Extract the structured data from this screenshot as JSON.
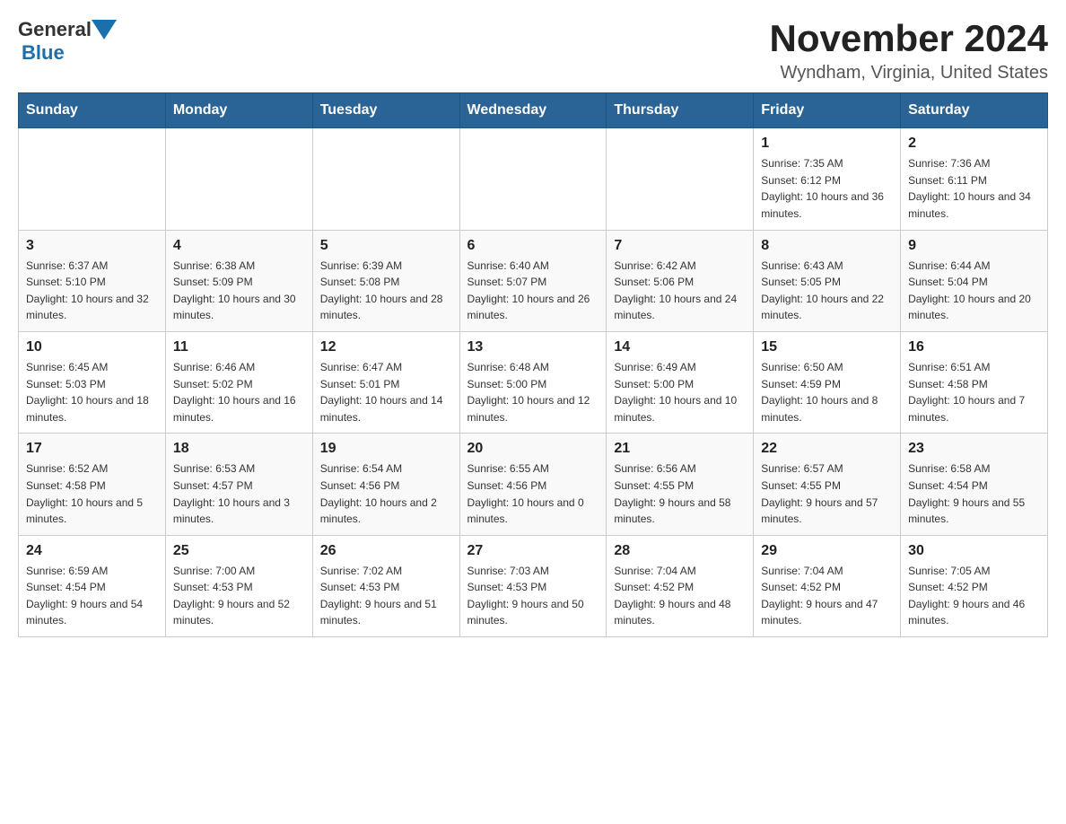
{
  "header": {
    "logo": {
      "general": "General",
      "blue": "Blue"
    },
    "title": "November 2024",
    "location": "Wyndham, Virginia, United States"
  },
  "calendar": {
    "days_of_week": [
      "Sunday",
      "Monday",
      "Tuesday",
      "Wednesday",
      "Thursday",
      "Friday",
      "Saturday"
    ],
    "weeks": [
      {
        "cells": [
          {
            "day": "",
            "info": ""
          },
          {
            "day": "",
            "info": ""
          },
          {
            "day": "",
            "info": ""
          },
          {
            "day": "",
            "info": ""
          },
          {
            "day": "",
            "info": ""
          },
          {
            "day": "1",
            "info": "Sunrise: 7:35 AM\nSunset: 6:12 PM\nDaylight: 10 hours and 36 minutes."
          },
          {
            "day": "2",
            "info": "Sunrise: 7:36 AM\nSunset: 6:11 PM\nDaylight: 10 hours and 34 minutes."
          }
        ]
      },
      {
        "cells": [
          {
            "day": "3",
            "info": "Sunrise: 6:37 AM\nSunset: 5:10 PM\nDaylight: 10 hours and 32 minutes."
          },
          {
            "day": "4",
            "info": "Sunrise: 6:38 AM\nSunset: 5:09 PM\nDaylight: 10 hours and 30 minutes."
          },
          {
            "day": "5",
            "info": "Sunrise: 6:39 AM\nSunset: 5:08 PM\nDaylight: 10 hours and 28 minutes."
          },
          {
            "day": "6",
            "info": "Sunrise: 6:40 AM\nSunset: 5:07 PM\nDaylight: 10 hours and 26 minutes."
          },
          {
            "day": "7",
            "info": "Sunrise: 6:42 AM\nSunset: 5:06 PM\nDaylight: 10 hours and 24 minutes."
          },
          {
            "day": "8",
            "info": "Sunrise: 6:43 AM\nSunset: 5:05 PM\nDaylight: 10 hours and 22 minutes."
          },
          {
            "day": "9",
            "info": "Sunrise: 6:44 AM\nSunset: 5:04 PM\nDaylight: 10 hours and 20 minutes."
          }
        ]
      },
      {
        "cells": [
          {
            "day": "10",
            "info": "Sunrise: 6:45 AM\nSunset: 5:03 PM\nDaylight: 10 hours and 18 minutes."
          },
          {
            "day": "11",
            "info": "Sunrise: 6:46 AM\nSunset: 5:02 PM\nDaylight: 10 hours and 16 minutes."
          },
          {
            "day": "12",
            "info": "Sunrise: 6:47 AM\nSunset: 5:01 PM\nDaylight: 10 hours and 14 minutes."
          },
          {
            "day": "13",
            "info": "Sunrise: 6:48 AM\nSunset: 5:00 PM\nDaylight: 10 hours and 12 minutes."
          },
          {
            "day": "14",
            "info": "Sunrise: 6:49 AM\nSunset: 5:00 PM\nDaylight: 10 hours and 10 minutes."
          },
          {
            "day": "15",
            "info": "Sunrise: 6:50 AM\nSunset: 4:59 PM\nDaylight: 10 hours and 8 minutes."
          },
          {
            "day": "16",
            "info": "Sunrise: 6:51 AM\nSunset: 4:58 PM\nDaylight: 10 hours and 7 minutes."
          }
        ]
      },
      {
        "cells": [
          {
            "day": "17",
            "info": "Sunrise: 6:52 AM\nSunset: 4:58 PM\nDaylight: 10 hours and 5 minutes."
          },
          {
            "day": "18",
            "info": "Sunrise: 6:53 AM\nSunset: 4:57 PM\nDaylight: 10 hours and 3 minutes."
          },
          {
            "day": "19",
            "info": "Sunrise: 6:54 AM\nSunset: 4:56 PM\nDaylight: 10 hours and 2 minutes."
          },
          {
            "day": "20",
            "info": "Sunrise: 6:55 AM\nSunset: 4:56 PM\nDaylight: 10 hours and 0 minutes."
          },
          {
            "day": "21",
            "info": "Sunrise: 6:56 AM\nSunset: 4:55 PM\nDaylight: 9 hours and 58 minutes."
          },
          {
            "day": "22",
            "info": "Sunrise: 6:57 AM\nSunset: 4:55 PM\nDaylight: 9 hours and 57 minutes."
          },
          {
            "day": "23",
            "info": "Sunrise: 6:58 AM\nSunset: 4:54 PM\nDaylight: 9 hours and 55 minutes."
          }
        ]
      },
      {
        "cells": [
          {
            "day": "24",
            "info": "Sunrise: 6:59 AM\nSunset: 4:54 PM\nDaylight: 9 hours and 54 minutes."
          },
          {
            "day": "25",
            "info": "Sunrise: 7:00 AM\nSunset: 4:53 PM\nDaylight: 9 hours and 52 minutes."
          },
          {
            "day": "26",
            "info": "Sunrise: 7:02 AM\nSunset: 4:53 PM\nDaylight: 9 hours and 51 minutes."
          },
          {
            "day": "27",
            "info": "Sunrise: 7:03 AM\nSunset: 4:53 PM\nDaylight: 9 hours and 50 minutes."
          },
          {
            "day": "28",
            "info": "Sunrise: 7:04 AM\nSunset: 4:52 PM\nDaylight: 9 hours and 48 minutes."
          },
          {
            "day": "29",
            "info": "Sunrise: 7:04 AM\nSunset: 4:52 PM\nDaylight: 9 hours and 47 minutes."
          },
          {
            "day": "30",
            "info": "Sunrise: 7:05 AM\nSunset: 4:52 PM\nDaylight: 9 hours and 46 minutes."
          }
        ]
      }
    ]
  }
}
